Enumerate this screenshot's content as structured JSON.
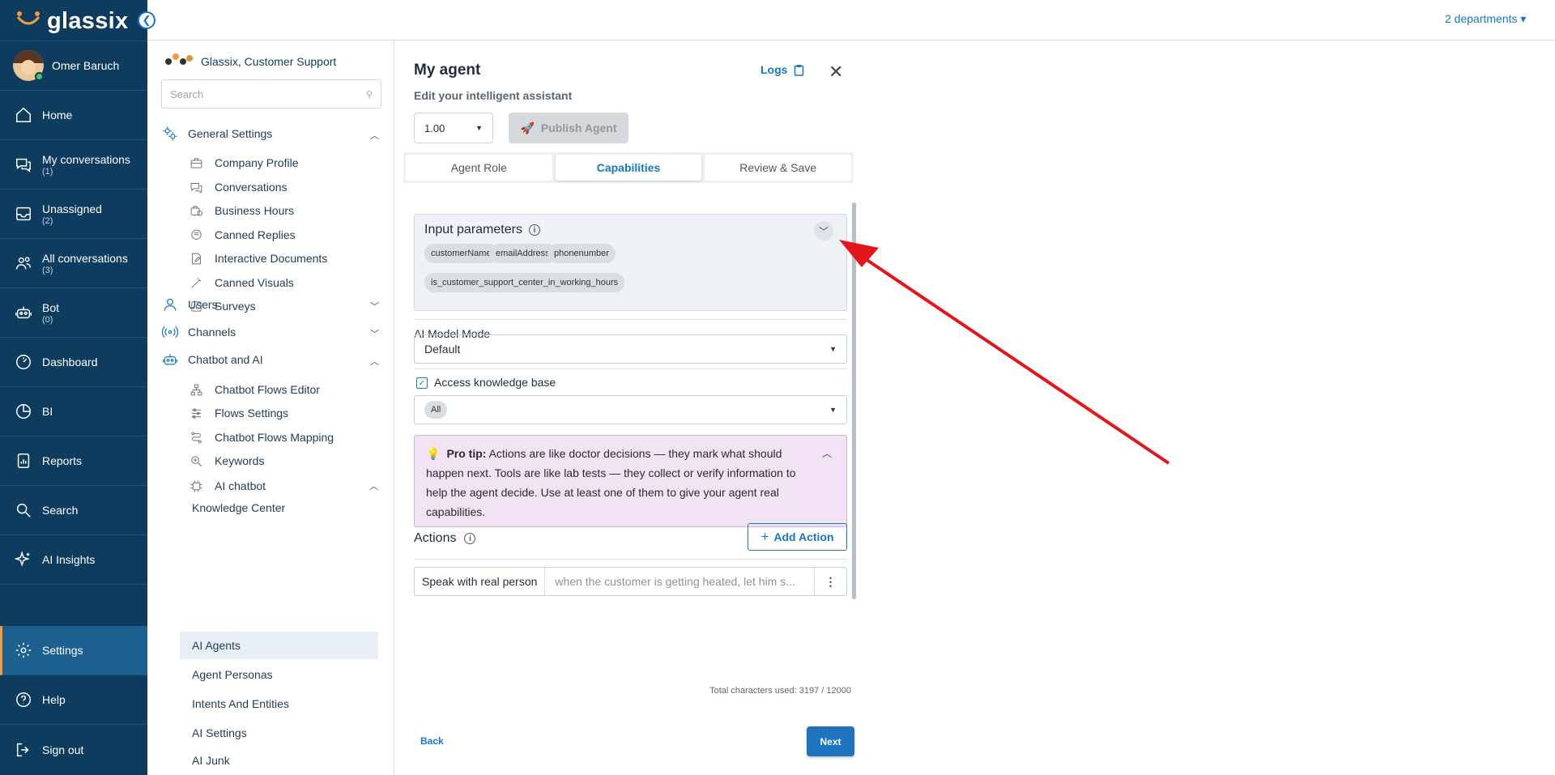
{
  "brand": {
    "logo_text": "glassix",
    "accent": "#1976c4",
    "nav_bg": "#0d3c5e",
    "settings_accent": "#f19a3e"
  },
  "topbar": {
    "departments": "2 departments ▾"
  },
  "user": {
    "name": "Omer Baruch"
  },
  "nav": [
    {
      "label": "Home",
      "icon": "home-icon",
      "count": ""
    },
    {
      "label": "My conversations",
      "icon": "chat-bubbles-icon",
      "count": "(1)"
    },
    {
      "label": "Unassigned",
      "icon": "inbox-icon",
      "count": "(2)"
    },
    {
      "label": "All conversations",
      "icon": "users-icon",
      "count": "(3)"
    },
    {
      "label": "Bot",
      "icon": "bot-icon",
      "count": "(0)"
    },
    {
      "label": "Dashboard",
      "icon": "dashboard-icon",
      "count": ""
    },
    {
      "label": "BI",
      "icon": "pie-chart-icon",
      "count": ""
    },
    {
      "label": "Reports",
      "icon": "report-icon",
      "count": ""
    },
    {
      "label": "Search",
      "icon": "search-icon",
      "count": ""
    },
    {
      "label": "AI Insights",
      "icon": "sparkles-icon",
      "count": ""
    },
    {
      "label": "Settings",
      "icon": "gear-icon",
      "count": ""
    },
    {
      "label": "Help",
      "icon": "help-icon",
      "count": ""
    },
    {
      "label": "Sign out",
      "icon": "sign-out-icon",
      "count": ""
    }
  ],
  "settings_panel": {
    "org": "Glassix, Customer Support",
    "search_placeholder": "Search",
    "general": "General Settings",
    "general_items": [
      "Company Profile",
      "Conversations",
      "Business Hours",
      "Canned Replies",
      "Interactive Documents",
      "Canned Visuals",
      "Surveys"
    ],
    "users": "Users",
    "channels": "Channels",
    "chatbot": "Chatbot and AI",
    "chatbot_items": [
      "Chatbot Flows Editor",
      "Flows Settings",
      "Chatbot Flows Mapping",
      "Keywords"
    ],
    "ai_chatbot": "AI chatbot",
    "ai_items": [
      "Knowledge Center",
      "AI Agents",
      "Agent Personas",
      "Intents And Entities",
      "AI Settings",
      "AI Junk"
    ]
  },
  "editor": {
    "title": "My agent",
    "subtitle": "Edit your intelligent assistant",
    "logs": "Logs",
    "version": "1.00",
    "publish": "Publish Agent",
    "tabs": [
      "Agent Role",
      "Capabilities",
      "Review & Save"
    ],
    "input_params_title": "Input parameters",
    "params": [
      "customerName",
      "emailAddress",
      "phonenumber",
      "is_customer_support_center_in_working_hours"
    ],
    "ai_model_label": "AI Model Mode",
    "ai_model_value": "Default",
    "kb_label": "Access knowledge base",
    "kb_chip": "All",
    "tip_bold": "Pro tip:",
    "tip_text": "Actions are like doctor decisions — they mark what should happen next. Tools are like lab tests — they collect or verify information to help the agent decide. Use at least one of them to give your agent real capabilities.",
    "actions_label": "Actions",
    "add_action": "Add Action",
    "action_name": "Speak with real person",
    "action_desc": "when the customer is getting heated, let him s...",
    "chars": "Total characters used: 3197 / 12000",
    "back": "Back",
    "next": "Next"
  }
}
